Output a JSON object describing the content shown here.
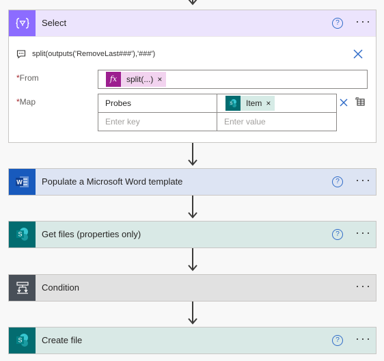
{
  "select": {
    "title": "Select",
    "help": "?",
    "more": "···",
    "expression": "split(outputs('RemoveLast###'),'###')",
    "from_label": "From",
    "from_token": "split(...)",
    "map_label": "Map",
    "map_key": "Probes",
    "map_value_token": "Item",
    "key_placeholder": "Enter key",
    "value_placeholder": "Enter value",
    "required_mark": "*",
    "token_remove": "×",
    "fx_text": "fx"
  },
  "steps": [
    {
      "title": "Populate a Microsoft Word template",
      "help": "?",
      "more": "···"
    },
    {
      "title": "Get files (properties only)",
      "help": "?",
      "more": "···"
    },
    {
      "title": "Condition",
      "more": "···"
    },
    {
      "title": "Create file",
      "help": "?",
      "more": "···"
    }
  ],
  "colors": {
    "select_header": "#ece4fd",
    "select_icon": "#8c6cff",
    "word_header": "#dde4f3",
    "word_icon": "#185abd",
    "sharepoint_header": "#d9e9e6",
    "sharepoint_icon": "#036c70",
    "condition_header": "#e1e1e1",
    "condition_icon": "#484f58",
    "fx_token": "#f2d3ef",
    "fx_icon": "#9c1f8f",
    "item_token": "#d6ebe6"
  },
  "icons": {
    "select": "data-operation-select-icon",
    "word": "word-icon",
    "sharepoint": "sharepoint-icon",
    "condition": "condition-icon",
    "comment": "comment-icon",
    "close": "close-icon",
    "fx": "expression-fx-icon",
    "delete_row": "delete-row-icon",
    "switch_mode": "switch-to-text-mode-icon",
    "help": "help-icon",
    "more": "more-options-icon"
  }
}
